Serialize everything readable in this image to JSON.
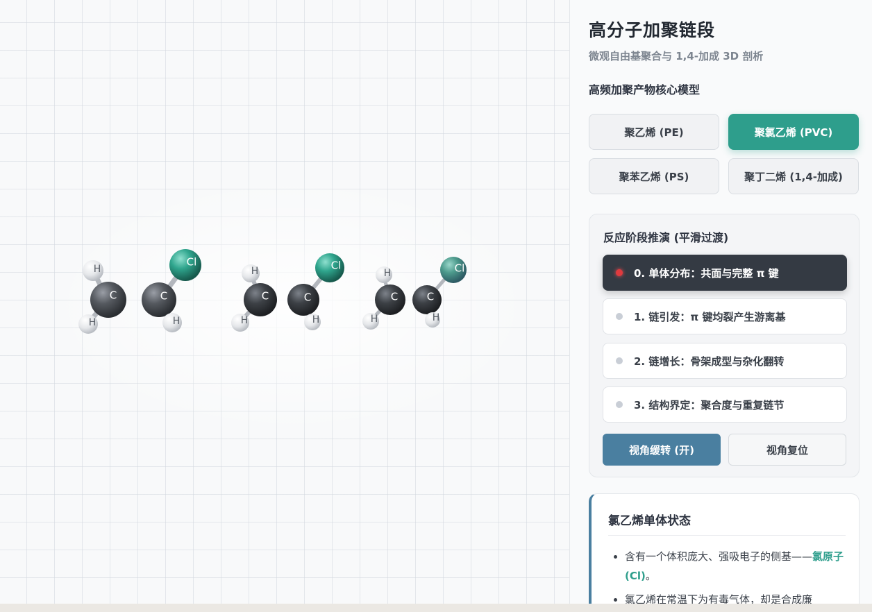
{
  "panel": {
    "title": "高分子加聚链段",
    "subtitle": "微观自由基聚合与 1,4-加成 3D 剖析",
    "models_label": "高频加聚产物核心模型",
    "models": [
      {
        "label": "聚乙烯 (PE)",
        "active": false
      },
      {
        "label": "聚氯乙烯 (PVC)",
        "active": true
      },
      {
        "label": "聚苯乙烯 (PS)",
        "active": false
      },
      {
        "label": "聚丁二烯 (1,4-加成)",
        "active": false
      }
    ],
    "stages_label": "反应阶段推演 (平滑过渡)",
    "stages": [
      {
        "label": "0. 单体分布：共面与完整 π 键",
        "active": true
      },
      {
        "label": "1. 链引发：π 键均裂产生游离基",
        "active": false
      },
      {
        "label": "2. 链增长：骨架成型与杂化翻转",
        "active": false
      },
      {
        "label": "3. 结构界定：聚合度与重复链节",
        "active": false
      }
    ],
    "rotate_button": "视角缓转 (开)",
    "reset_button": "视角复位",
    "info": {
      "title": "氯乙烯单体状态",
      "item1_pre": "含有一个体积庞大、强吸电子的侧基——",
      "item1_highlight": "氯原子 (Cl)",
      "item1_post": "。",
      "item2": "氯乙烯在常温下为有毒气体，却是合成廉"
    }
  },
  "molecules": [
    {
      "atoms": [
        "H",
        "C",
        "C",
        "Cl",
        "H",
        "H"
      ]
    },
    {
      "atoms": [
        "H",
        "C",
        "C",
        "Cl",
        "H",
        "H"
      ]
    },
    {
      "atoms": [
        "H",
        "C",
        "C",
        "Cl",
        "H",
        "H"
      ]
    }
  ],
  "colors": {
    "accent": "#2e9e8c",
    "active_step": "#343a43",
    "red_dot": "#e03a3e",
    "primary_btn": "#4a7fa0"
  }
}
